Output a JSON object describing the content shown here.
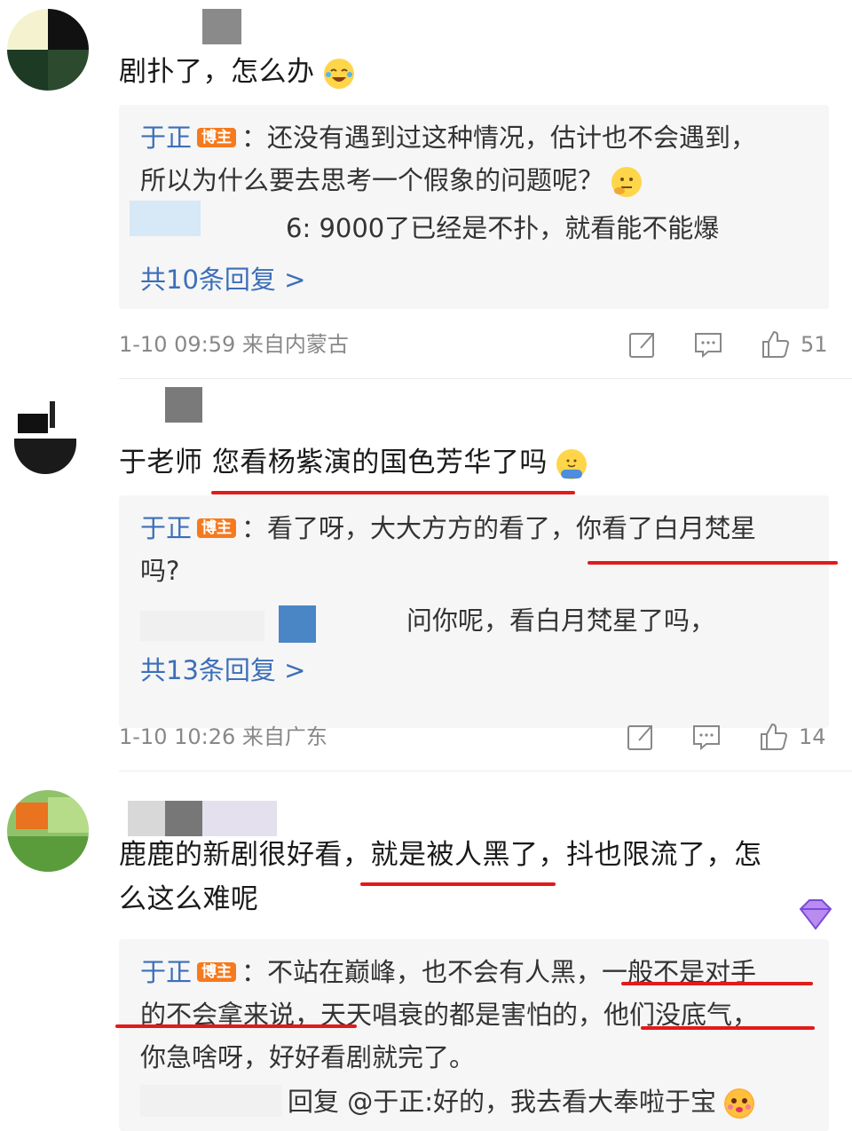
{
  "comments": [
    {
      "text": "剧扑了，怎么办",
      "reply_author": "于正",
      "badge": "博主",
      "reply_line1": "：还没有遇到过这种情况，估计也不会遇到，",
      "reply_line2": "所以为什么要去思考一个假象的问题呢？",
      "sub_reply": "6: 9000了已经是不扑，就看能不能爆",
      "more": "共10条回复 >",
      "time": "1-10 09:59  来自内蒙古",
      "likes": "51"
    },
    {
      "text_prefix": "于老师 ",
      "text_highlight": "您看杨紫演的国色芳华了吗",
      "reply_author": "于正",
      "badge": "博主",
      "reply_line1": "：看了呀，大大方方的看了，你看了白月梵星",
      "reply_line2": "吗?",
      "sub_reply": "问你呢，看白月梵星了吗，",
      "more": "共13条回复 >",
      "time": "1-10 10:26  来自广东",
      "likes": "14"
    },
    {
      "text_line1": "鹿鹿的新剧很好看，就是被人黑了，抖也限流了，怎",
      "text_line2": "么这么难呢",
      "reply_author": "于正",
      "badge": "博主",
      "reply_line1": "：不站在巅峰，也不会有人黑，一般不是对手",
      "reply_line2": "的不会拿来说，天天唱衰的都是害怕的，他们没底气，",
      "reply_line3": "你急啥呀，好好看剧就完了。",
      "sub_reply": "回复 @于正:好的，我去看大奉啦于宝"
    }
  ],
  "colors": {
    "link": "#3c6fb8",
    "badge": "#f57a1f",
    "underline": "#e31a1a",
    "meta": "#888888"
  },
  "icons": [
    "share-icon",
    "comment-icon",
    "like-icon",
    "laugh-cry-emoji",
    "think-emoji",
    "hug-emoji",
    "cute-emoji",
    "diamond-badge-icon"
  ]
}
